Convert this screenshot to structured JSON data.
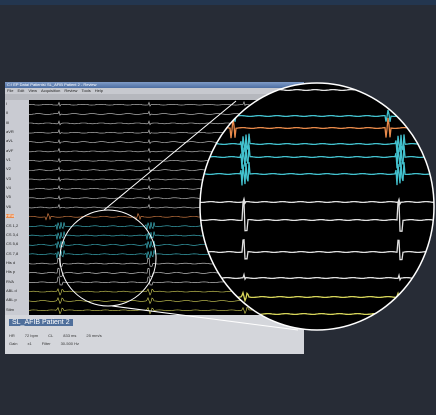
{
  "window": {
    "title": "C:\\ EP Data\\  Patients\\ SL_AFIB Patient 2 - Review",
    "menu": [
      "File",
      "Edit",
      "View",
      "Acquisition",
      "Review",
      "Tools",
      "Help"
    ]
  },
  "channels": [
    {
      "label": "I",
      "color": "#cfcfcf"
    },
    {
      "label": "II",
      "color": "#cfcfcf"
    },
    {
      "label": "III",
      "color": "#cfcfcf"
    },
    {
      "label": "aVR",
      "color": "#cfcfcf"
    },
    {
      "label": "aVL",
      "color": "#cfcfcf"
    },
    {
      "label": "aVF",
      "color": "#cfcfcf"
    },
    {
      "label": "V1",
      "color": "#cfcfcf"
    },
    {
      "label": "V2",
      "color": "#cfcfcf"
    },
    {
      "label": "V3",
      "color": "#cfcfcf"
    },
    {
      "label": "V4",
      "color": "#cfcfcf"
    },
    {
      "label": "V5",
      "color": "#cfcfcf"
    },
    {
      "label": "V6",
      "color": "#cfcfcf"
    },
    {
      "label": "HRA",
      "color": "#e98a4a",
      "highlight": true
    },
    {
      "label": "CS 1,2",
      "color": "#43c2cf"
    },
    {
      "label": "CS 3,4",
      "color": "#43c2cf"
    },
    {
      "label": "CS 5,6",
      "color": "#43c2cf"
    },
    {
      "label": "CS 7,8",
      "color": "#43c2cf"
    },
    {
      "label": "His d",
      "color": "#dcdcdc"
    },
    {
      "label": "His p",
      "color": "#dcdcdc"
    },
    {
      "label": "RVA",
      "color": "#dcdcdc"
    },
    {
      "label": "ABL d",
      "color": "#d6d45a"
    },
    {
      "label": "ABL p",
      "color": "#d6d45a"
    },
    {
      "label": "Stim",
      "color": "#d6d45a"
    }
  ],
  "status": {
    "patient": "SL_AFIB Patient 2",
    "row1": [
      "HR",
      "72 bpm",
      "CL",
      "833 ms",
      "25 mm/s"
    ],
    "row2": [
      "Gain",
      "x1",
      "Filter",
      "30-500 Hz"
    ]
  }
}
